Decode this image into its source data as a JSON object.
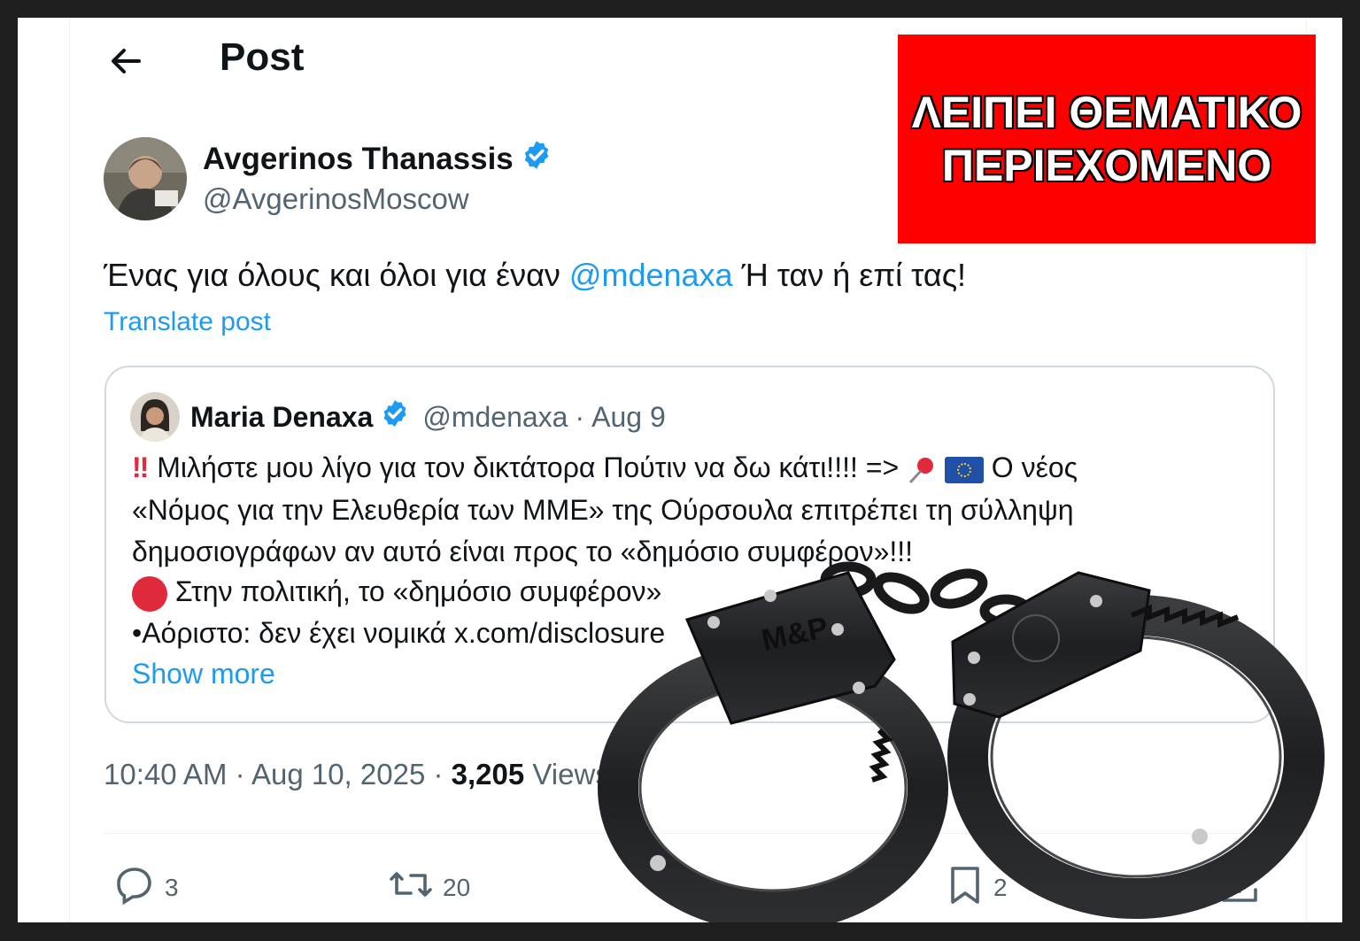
{
  "header": {
    "back_icon": "arrow-left-icon",
    "title": "Post"
  },
  "author": {
    "name": "Avgerinos Thanassis",
    "handle": "@AvgerinosMoscow",
    "verified_icon": "verified-badge-icon"
  },
  "post": {
    "text_before": "Ένας για όλους και όλοι για έναν ",
    "mention": "@mdenaxa",
    "text_after": " Ή ταν ή επί τας!",
    "translate_label": "Translate post"
  },
  "quote": {
    "name": "Maria Denaxa",
    "handle": "@mdenaxa",
    "separator": " · ",
    "date": "Aug 9",
    "line1_bang": "‼",
    "line1": " Μιλήστε μου λίγο για τον δικτάτορα Πούτιν να δω κάτι!!!! => ",
    "line1_end": " Ο νέος",
    "line2": "«Νόμος για την Ελευθερία των ΜΜΕ» της Ούρσουλα επιτρέπει τη σύλληψη",
    "line3": "δημοσιογράφων αν αυτό είναι προς το «δημόσιο συμφέρον»!!!",
    "line4": " Στην πολιτική, το «δημόσιο συμφέρον»",
    "line5": "•Αόριστο: δεν έχει νομικά x.com/disclosure",
    "show_more": "Show more"
  },
  "meta": {
    "time": "10:40 AM",
    "sep1": " · ",
    "date": "Aug 10, 2025",
    "sep2": " · ",
    "views_count": "3,205",
    "views_label": " Views"
  },
  "actions": {
    "replies": "3",
    "reposts": "20",
    "bookmarks": "2"
  },
  "banner": {
    "line1": "ΛΕΙΠΕΙ ΘΕΜΑΤΙΚΟ",
    "line2": "ΠΕΡΙΕΧΟΜΕΝΟ"
  },
  "overlay": {
    "image_icon": "handcuffs-icon",
    "brand": "M&P"
  },
  "colors": {
    "link": "#1d9bf0",
    "banner": "#ff0000",
    "text": "#0f1419",
    "muted": "#536471"
  }
}
